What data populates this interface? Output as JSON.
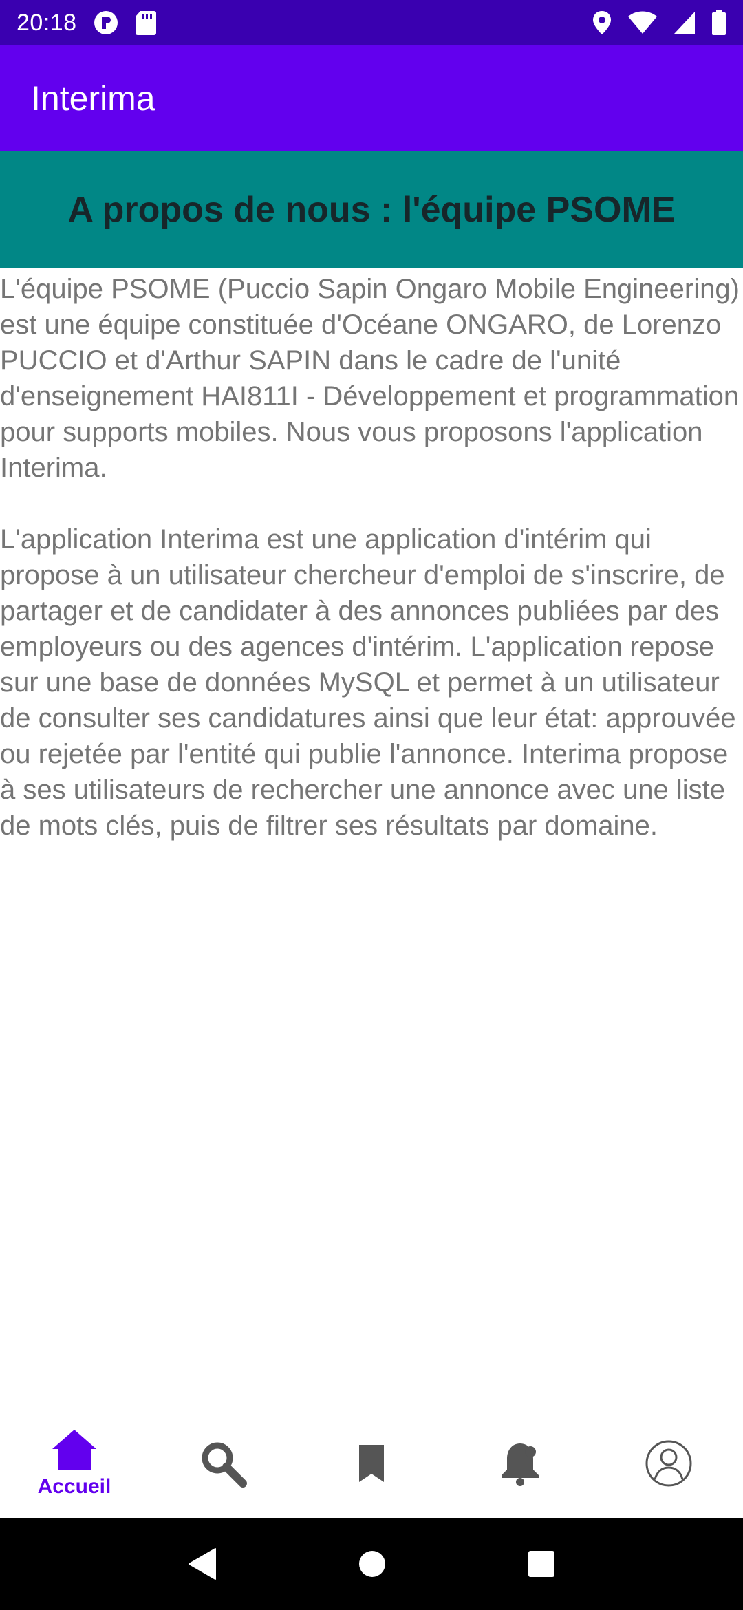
{
  "status_bar": {
    "time": "20:18",
    "left_icons": [
      "media-icon",
      "sd-card-icon"
    ],
    "right_icons": [
      "location-icon",
      "wifi-icon",
      "signal-icon",
      "battery-icon"
    ]
  },
  "app_bar": {
    "title": "Interima"
  },
  "banner": {
    "title": "A propos de nous : l'équipe PSOME"
  },
  "content": {
    "paragraph_1": "L'équipe PSOME (Puccio Sapin Ongaro Mobile Engineering) est une équipe constituée d'Océane ONGARO, de Lorenzo PUCCIO et d'Arthur SAPIN dans le cadre de l'unité d'enseignement HAI811I - Développement et programmation pour supports mobiles. Nous vous proposons l'application Interima.",
    "paragraph_2": "L'application Interima est une application d'intérim qui propose à un utilisateur chercheur d'emploi de s'inscrire, de partager et de candidater à des annonces publiées par des employeurs ou des agences d'intérim. L'application repose sur une base de données MySQL et permet à un utilisateur de consulter ses candidatures ainsi que leur état: approuvée ou rejetée par l'entité qui publie l'annonce. Interima propose à ses utilisateurs de rechercher une annonce avec une liste de mots clés, puis de filtrer ses résultats par domaine."
  },
  "bottom_nav": {
    "items": [
      {
        "icon": "home-icon",
        "label": "Accueil",
        "selected": true
      },
      {
        "icon": "search-icon",
        "label": "",
        "selected": false
      },
      {
        "icon": "bookmark-icon",
        "label": "",
        "selected": false
      },
      {
        "icon": "notification-bell-icon",
        "label": "",
        "selected": false
      },
      {
        "icon": "profile-icon",
        "label": "",
        "selected": false
      }
    ]
  },
  "system_nav": {
    "buttons": [
      "back-icon",
      "home-circle-icon",
      "recents-icon"
    ]
  },
  "colors": {
    "status_bar": "#3a00b0",
    "app_bar": "#6200ee",
    "banner": "#018786",
    "banner_text": "#17262a",
    "body_text": "#757575",
    "nav_selected": "#6200ee",
    "nav_unselected": "#555555",
    "system_nav": "#000000"
  }
}
